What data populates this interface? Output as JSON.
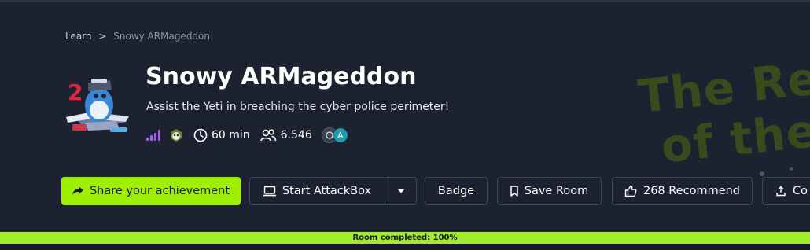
{
  "breadcrumb": {
    "parent": "Learn",
    "separator": ">",
    "current": "Snowy ARMageddon"
  },
  "room": {
    "title": "Snowy ARMageddon",
    "subtitle": "Assist the Yeti in breaching the cyber police perimeter!",
    "day_badge": "2",
    "difficulty": "hard",
    "duration": "60 min",
    "users": "6.546",
    "avatar_initial": "A"
  },
  "watermark": {
    "line1": "The Re",
    "line2": "of the"
  },
  "buttons": {
    "share": "Share your achievement",
    "attackbox": "Start AttackBox",
    "badge": "Badge",
    "save": "Save Room",
    "recommend": "268 Recommend",
    "more": "Co"
  },
  "progress": {
    "label": "Room completed: 100%",
    "value": 1.0
  },
  "colors": {
    "accent": "#9fef00",
    "background": "#1c2230",
    "difficulty": "#a660ef"
  }
}
